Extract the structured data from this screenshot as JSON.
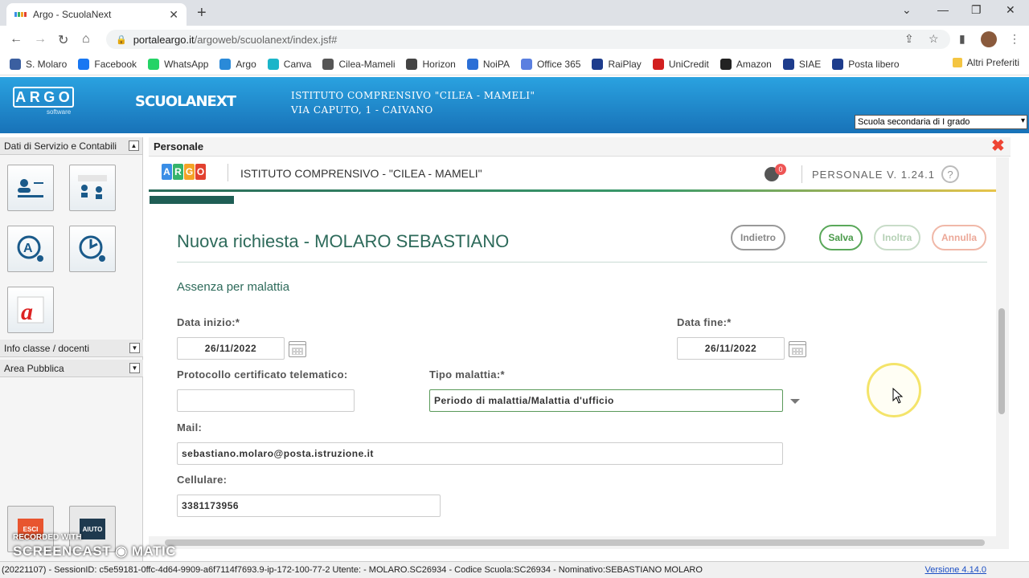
{
  "browser": {
    "tab_title": "Argo - ScuolaNext",
    "url_host": "portaleargo.it",
    "url_path": "/argoweb/scuolanext/index.jsf#",
    "bookmarks": [
      {
        "label": "S. Molaro",
        "icon": "user-icon",
        "color": "#3b5fa0"
      },
      {
        "label": "Facebook",
        "icon": "facebook-icon",
        "color": "#1877f2"
      },
      {
        "label": "WhatsApp",
        "icon": "whatsapp-icon",
        "color": "#25d366"
      },
      {
        "label": "Argo",
        "icon": "argo-icon",
        "color": "#2a8ad8"
      },
      {
        "label": "Canva",
        "icon": "canva-icon",
        "color": "#1bb5c9"
      },
      {
        "label": "Cilea-Mameli",
        "icon": "school-icon",
        "color": "#555555"
      },
      {
        "label": "Horizon",
        "icon": "horizon-icon",
        "color": "#444444"
      },
      {
        "label": "NoiPA",
        "icon": "noipa-icon",
        "color": "#2b6fd6"
      },
      {
        "label": "Office 365",
        "icon": "office-icon",
        "color": "#5a7fe0"
      },
      {
        "label": "RaiPlay",
        "icon": "raiplay-icon",
        "color": "#1d3c8c"
      },
      {
        "label": "UniCredit",
        "icon": "unicredit-icon",
        "color": "#d21f1f"
      },
      {
        "label": "Amazon",
        "icon": "amazon-icon",
        "color": "#222222"
      },
      {
        "label": "SIAE",
        "icon": "siae-icon",
        "color": "#1d3c8c"
      },
      {
        "label": "Posta libero",
        "icon": "libero-icon",
        "color": "#1d3c8c"
      }
    ],
    "other_bookmarks": "Altri Preferiti"
  },
  "header": {
    "logo": "ARGO",
    "logo_sub": "software",
    "product": "SCUOLANEXT",
    "school_line1": "ISTITUTO COMPRENSIVO \"CILEA - MAMELI\"",
    "school_line2": "VIA CAPUTO, 1 - CAIVANO",
    "school_select": "Scuola secondaria di I grado"
  },
  "sidebar": {
    "sections": [
      "Dati di Servizio e Contabili",
      "Info classe / docenti",
      "Area Pubblica"
    ],
    "bottom": {
      "exit": "ESCI",
      "help": "AIUTO"
    }
  },
  "panel": {
    "title": "Personale"
  },
  "app": {
    "logo_letters": [
      "A",
      "R",
      "G",
      "O"
    ],
    "logo_colors": [
      "#3a8ee6",
      "#35b36b",
      "#f4a326",
      "#e2412f"
    ],
    "school": "ISTITUTO COMPRENSIVO - \"CILEA - MAMELI\"",
    "notif_count": "0",
    "version": "PERSONALE V. 1.24.1",
    "help": "?",
    "progress": 0.1
  },
  "form": {
    "title": "Nuova richiesta - MOLARO SEBASTIANO",
    "buttons": {
      "back": "Indietro",
      "save": "Salva",
      "forward": "Inoltra",
      "cancel": "Annulla"
    },
    "section": "Assenza per malattia",
    "start_label": "Data inizio:*",
    "start_value": "26/11/2022",
    "end_label": "Data fine:*",
    "end_value": "26/11/2022",
    "protocol_label": "Protocollo certificato telematico:",
    "protocol_value": "",
    "type_label": "Tipo malattia:*",
    "type_value": "Periodo di malattia/Malattia d'ufficio",
    "mail_label": "Mail:",
    "mail_value": "sebastiano.molaro@posta.istruzione.it",
    "phone_label": "Cellulare:",
    "phone_value": "3381173956"
  },
  "status": {
    "text": "(20221107) - SessionID: c5e59181-0ffc-4d64-9909-a6f7114f7693.9-ip-172-100-77-2 Utente: - MOLARO.SC26934 - Codice Scuola:SC26934 - Nominativo:SEBASTIANO MOLARO",
    "version": "Versione 4.14.0"
  },
  "watermark": {
    "line1": "RECORDED WITH",
    "line2": "SCREENCAST ◉ MATIC"
  }
}
